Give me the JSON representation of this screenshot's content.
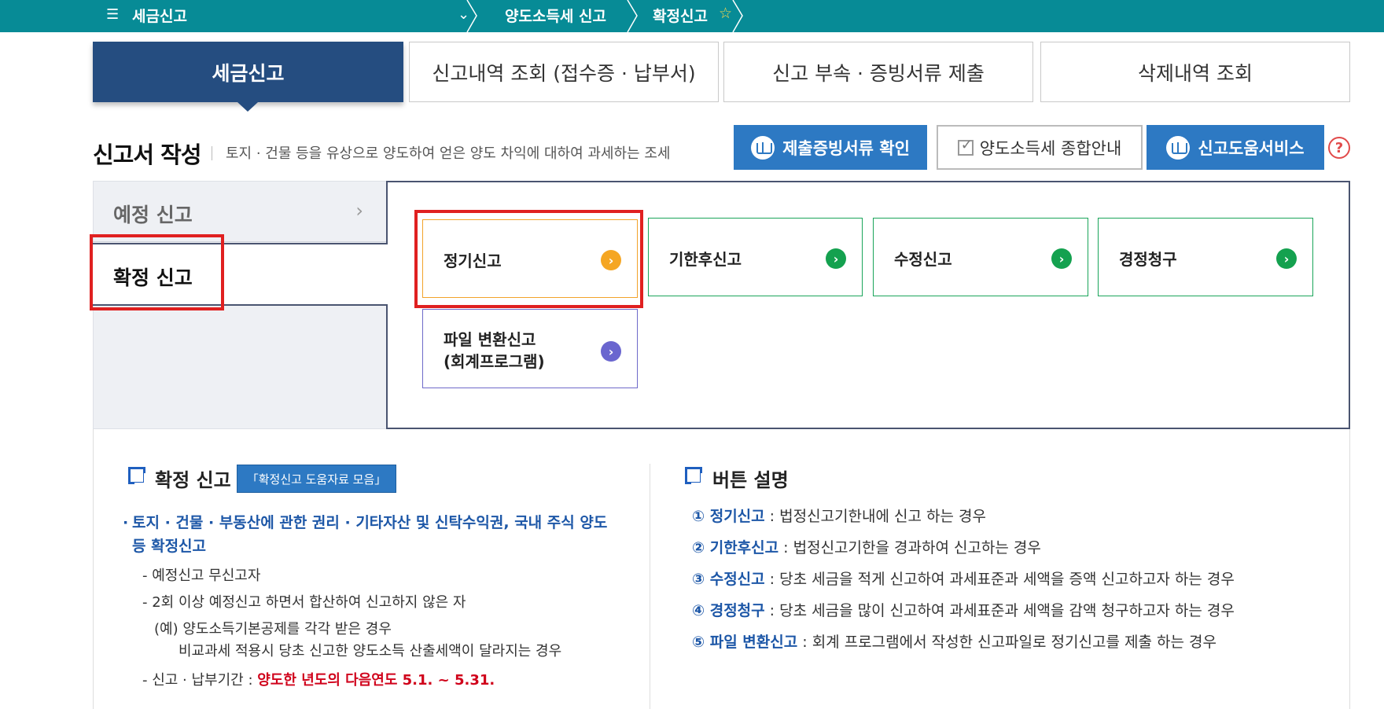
{
  "topbar": {
    "menu_title": "세금신고",
    "crumb1": "양도소득세 신고",
    "crumb2": "확정신고"
  },
  "tabs": [
    {
      "label": "세금신고"
    },
    {
      "label": "신고내역 조회 (접수증 · 납부서)"
    },
    {
      "label": "신고 부속 · 증빙서류 제출"
    },
    {
      "label": "삭제내역 조회"
    }
  ],
  "section": {
    "title": "신고서 작성",
    "desc": "토지 · 건물 등을 유상으로 양도하여 얻은 양도 차익에 대하여 과세하는 조세"
  },
  "header_buttons": {
    "proof_docs": "제출증빙서류 확인",
    "guide": "양도소득세 종합안내",
    "help_service": "신고도움서비스"
  },
  "left_menu": {
    "prelim": "예정 신고",
    "final": "확정 신고"
  },
  "cards": {
    "regular": "정기신고",
    "late": "기한후신고",
    "amend": "수정신고",
    "correction": "경정청구",
    "file_line1": "파일 변환신고",
    "file_line2": "(회계프로그램)"
  },
  "bottom_left": {
    "title": "확정 신고",
    "help_btn": "「확정신고 도움자료 모음」",
    "bullet": "토지 · 건물 · 부동산에 관한 권리 · 기타자산 및 신탁수익권, 국내 주식 양도 등 확정신고",
    "dash1": "- 예정신고 무신고자",
    "dash2": "- 2회 이상 예정신고 하면서 합산하여 신고하지 않은 자",
    "example1": "(예) 양도소득기본공제를 각각 받은 경우",
    "example2": "비교과세 적용시 당초 신고한 양도소득 산출세액이 달라지는 경우",
    "period_label": "- 신고 · 납부기간 : ",
    "period_value": "양도한 년도의 다음연도 5.1. ~ 5.31."
  },
  "bottom_right": {
    "title": "버튼 설명",
    "items": [
      {
        "num": "①",
        "key": "정기신고",
        "text": " : 법정신고기한내에 신고 하는 경우"
      },
      {
        "num": "②",
        "key": "기한후신고",
        "text": " : 법정신고기한을 경과하여 신고하는 경우"
      },
      {
        "num": "③",
        "key": "수정신고",
        "text": " : 당초 세금을 적게 신고하여 과세표준과 세액을 증액 신고하고자 하는 경우"
      },
      {
        "num": "④",
        "key": "경정청구",
        "text": " : 당초 세금을 많이 신고하여 과세표준과 세액을 감액 청구하고자 하는 경우"
      },
      {
        "num": "⑤",
        "key": "파일 변환신고",
        "text": " : 회계 프로그램에서 작성한 신고파일로 정기신고를  제출 하는 경우"
      }
    ]
  },
  "colors": {
    "topbar": "#078b96",
    "active_tab": "#254d80",
    "blue_button": "#2d79c3",
    "highlight_red": "#e02020",
    "go_green": "#14a14f",
    "go_orange": "#f5a623",
    "go_purple": "#6a66cf"
  }
}
